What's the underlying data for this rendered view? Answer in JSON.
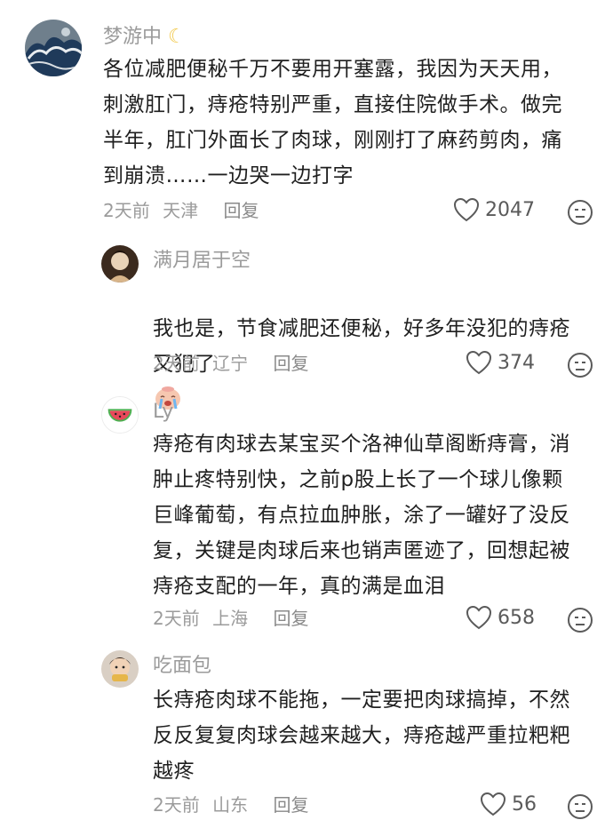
{
  "comments": [
    {
      "user": "梦游中",
      "user_emoji": "☾",
      "text": "各位减肥便秘千万不要用开塞露，我因为天天用，\n刺激肛门，痔疮特别严重，直接住院做手术。做完\n半年，肛门外面长了肉球，刚刚打了麻药剪肉，痛\n到崩溃……一边哭一边打字",
      "time": "2天前",
      "location": "天津",
      "reply": "回复",
      "likes": "2047"
    },
    {
      "user": "满月居于空",
      "text": "我也是，节食减肥还便秘，好多年没犯的痔疮\n又犯了",
      "time": "2天前",
      "location": "辽宁",
      "reply": "回复",
      "likes": "374"
    },
    {
      "user": "Ly",
      "text": "痔疮有肉球去某宝买个洛神仙草阁断痔膏，消\n肿止疼特别快，之前p股上长了一个球儿像颗\n巨峰葡萄，有点拉血肿胀，涂了一罐好了没反\n复，关键是肉球后来也销声匿迹了，回想起被\n痔疮支配的一年，真的满是血泪",
      "time": "2天前",
      "location": "上海",
      "reply": "回复",
      "likes": "658"
    },
    {
      "user": "吃面包",
      "text": "长痔疮肉球不能拖，一定要把肉球搞掉，不然\n反反复复肉球会越来越大，痔疮越严重拉粑粑\n越疼",
      "time": "2天前",
      "location": "山东",
      "reply": "回复",
      "likes": "56"
    }
  ],
  "icons": {
    "heart": "heart-icon",
    "dislike": "dislike-face-icon",
    "crying": "crying-face-emoji"
  }
}
